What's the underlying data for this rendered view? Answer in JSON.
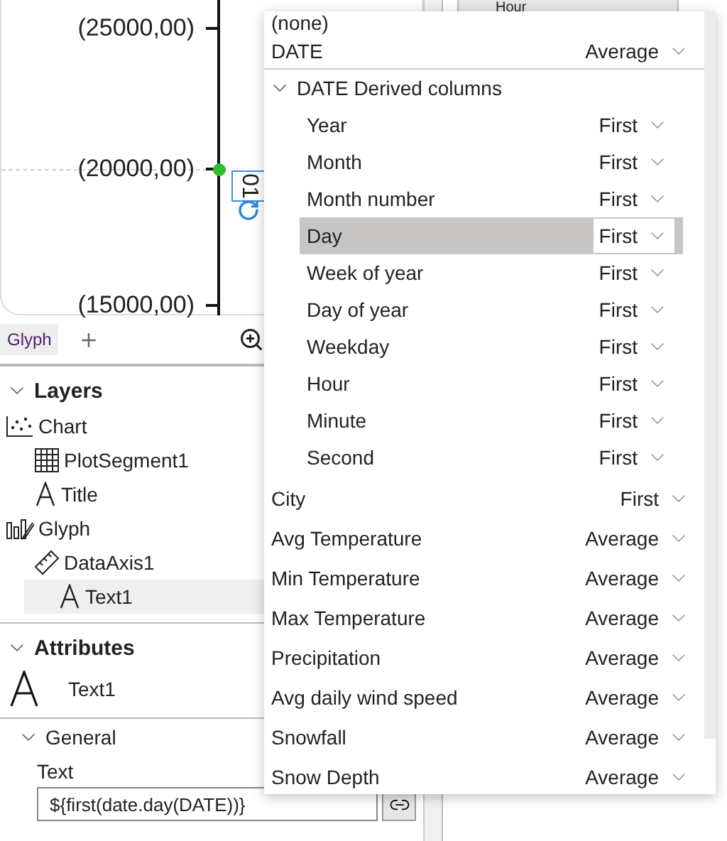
{
  "canvas": {
    "y_ticks": [
      "(25000,00)",
      "(20000,00)",
      "(15000,00)"
    ],
    "text_glyph": "01"
  },
  "canvas_tabs": [
    {
      "label": "Glyph",
      "selected": true
    }
  ],
  "layers": {
    "title": "Layers",
    "expanded": true,
    "items": [
      {
        "label": "Chart",
        "kind": "chart",
        "selected": false,
        "children": [
          {
            "label": "PlotSegment1",
            "kind": "plot-segment",
            "selected": false
          },
          {
            "label": "Title",
            "kind": "text",
            "selected": false
          }
        ]
      },
      {
        "label": "Glyph",
        "kind": "glyph",
        "selected": false,
        "children": [
          {
            "label": "DataAxis1",
            "kind": "axis",
            "selected": false
          },
          {
            "label": "Text1",
            "kind": "text",
            "selected": true
          }
        ]
      }
    ]
  },
  "attributes": {
    "title": "Attributes",
    "expanded": true,
    "object": "Text1",
    "section": {
      "title": "General",
      "expanded": true,
      "field_label": "Text",
      "field_value": "${first(date.day(DATE))}"
    }
  },
  "right_panel": {
    "header": "Hour"
  },
  "dropdown": {
    "items": [
      {
        "kind": "plain",
        "label": "(none)",
        "selected": false
      },
      {
        "kind": "column",
        "label": "DATE",
        "aggregation": "Average",
        "selected": false
      },
      {
        "kind": "group",
        "label": "DATE Derived columns",
        "expanded": true,
        "children": [
          {
            "label": "Year",
            "aggregation": "First",
            "selected": false
          },
          {
            "label": "Month",
            "aggregation": "First",
            "selected": false
          },
          {
            "label": "Month number",
            "aggregation": "First",
            "selected": false
          },
          {
            "label": "Day",
            "aggregation": "First",
            "selected": true
          },
          {
            "label": "Week of year",
            "aggregation": "First",
            "selected": false
          },
          {
            "label": "Day of year",
            "aggregation": "First",
            "selected": false
          },
          {
            "label": "Weekday",
            "aggregation": "First",
            "selected": false
          },
          {
            "label": "Hour",
            "aggregation": "First",
            "selected": false
          },
          {
            "label": "Minute",
            "aggregation": "First",
            "selected": false
          },
          {
            "label": "Second",
            "aggregation": "First",
            "selected": false
          }
        ]
      },
      {
        "kind": "column",
        "label": "City",
        "aggregation": "First",
        "selected": false
      },
      {
        "kind": "column",
        "label": "Avg Temperature",
        "aggregation": "Average",
        "selected": false
      },
      {
        "kind": "column",
        "label": "Min Temperature",
        "aggregation": "Average",
        "selected": false
      },
      {
        "kind": "column",
        "label": "Max Temperature",
        "aggregation": "Average",
        "selected": false
      },
      {
        "kind": "column",
        "label": "Precipitation",
        "aggregation": "Average",
        "selected": false
      },
      {
        "kind": "column",
        "label": "Avg daily wind speed",
        "aggregation": "Average",
        "selected": false
      },
      {
        "kind": "column",
        "label": "Snowfall",
        "aggregation": "Average",
        "selected": false
      },
      {
        "kind": "column",
        "label": "Snow Depth",
        "aggregation": "Average",
        "selected": false
      }
    ]
  }
}
